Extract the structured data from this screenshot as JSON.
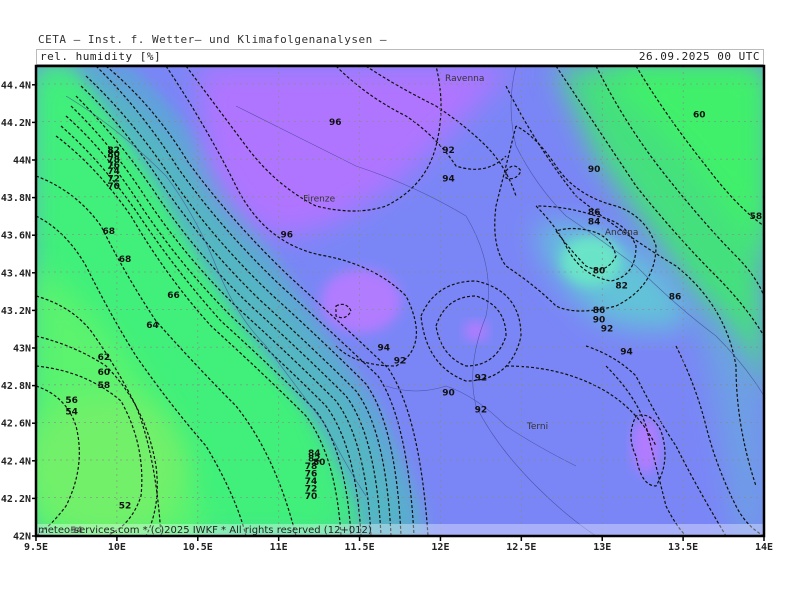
{
  "header": {
    "title": "CETA — Inst. f. Wetter— und Klimafolgenanalysen —",
    "parameter": "rel. humidity [%]",
    "datetime": "26.09.2025 00 UTC"
  },
  "map": {
    "lon_range": [
      9.5,
      14.0
    ],
    "lat_range": [
      42.0,
      44.5
    ],
    "x_ticks": [
      "9.5E",
      "10E",
      "10.5E",
      "11E",
      "11.5E",
      "12E",
      "12.5E",
      "13E",
      "13.5E",
      "14E"
    ],
    "y_ticks": [
      "42N",
      "42.2N",
      "42.4N",
      "42.6N",
      "42.8N",
      "43N",
      "43.2N",
      "43.4N",
      "43.6N",
      "43.8N",
      "44N",
      "44.2N",
      "44.4N"
    ],
    "cities": [
      {
        "name": "Ravenna",
        "lon": 12.15,
        "lat": 44.42
      },
      {
        "name": "Firenze",
        "lon": 11.25,
        "lat": 43.78
      },
      {
        "name": "Ancona",
        "lon": 13.12,
        "lat": 43.6
      },
      {
        "name": "Terni",
        "lon": 12.6,
        "lat": 42.57
      }
    ],
    "contour_labels": [
      {
        "text": "96",
        "lon": 11.35,
        "lat": 44.2
      },
      {
        "text": "92",
        "lon": 12.05,
        "lat": 44.05
      },
      {
        "text": "94",
        "lon": 12.05,
        "lat": 43.9
      },
      {
        "text": "90",
        "lon": 12.95,
        "lat": 43.95
      },
      {
        "text": "96",
        "lon": 11.05,
        "lat": 43.6
      },
      {
        "text": "94",
        "lon": 11.65,
        "lat": 43.0
      },
      {
        "text": "92",
        "lon": 11.75,
        "lat": 42.93
      },
      {
        "text": "90",
        "lon": 12.05,
        "lat": 42.76
      },
      {
        "text": "92",
        "lon": 12.25,
        "lat": 42.84
      },
      {
        "text": "92",
        "lon": 12.25,
        "lat": 42.67
      },
      {
        "text": "86",
        "lon": 12.95,
        "lat": 43.72
      },
      {
        "text": "84",
        "lon": 12.95,
        "lat": 43.67
      },
      {
        "text": "80",
        "lon": 12.98,
        "lat": 43.41
      },
      {
        "text": "82",
        "lon": 13.12,
        "lat": 43.33
      },
      {
        "text": "86",
        "lon": 12.98,
        "lat": 43.2
      },
      {
        "text": "90",
        "lon": 12.98,
        "lat": 43.15
      },
      {
        "text": "92",
        "lon": 13.03,
        "lat": 43.1
      },
      {
        "text": "94",
        "lon": 13.15,
        "lat": 42.98
      },
      {
        "text": "86",
        "lon": 13.45,
        "lat": 43.27
      },
      {
        "text": "60",
        "lon": 13.6,
        "lat": 44.24
      },
      {
        "text": "58",
        "lon": 13.95,
        "lat": 43.7
      },
      {
        "text": "68",
        "lon": 9.95,
        "lat": 43.62
      },
      {
        "text": "68",
        "lon": 10.05,
        "lat": 43.47
      },
      {
        "text": "66",
        "lon": 10.35,
        "lat": 43.28
      },
      {
        "text": "64",
        "lon": 10.22,
        "lat": 43.12
      },
      {
        "text": "62",
        "lon": 9.92,
        "lat": 42.95
      },
      {
        "text": "60",
        "lon": 9.92,
        "lat": 42.87
      },
      {
        "text": "58",
        "lon": 9.92,
        "lat": 42.8
      },
      {
        "text": "56",
        "lon": 9.72,
        "lat": 42.72
      },
      {
        "text": "54",
        "lon": 9.72,
        "lat": 42.66
      },
      {
        "text": "52",
        "lon": 10.05,
        "lat": 42.16
      },
      {
        "text": "54",
        "lon": 9.75,
        "lat": 42.03
      },
      {
        "text": "70",
        "lon": 9.98,
        "lat": 43.86
      },
      {
        "text": "72",
        "lon": 9.98,
        "lat": 43.9
      },
      {
        "text": "74",
        "lon": 9.98,
        "lat": 43.94
      },
      {
        "text": "76",
        "lon": 9.98,
        "lat": 43.97
      },
      {
        "text": "78",
        "lon": 9.98,
        "lat": 44.0
      },
      {
        "text": "80",
        "lon": 9.98,
        "lat": 44.03
      },
      {
        "text": "82",
        "lon": 9.98,
        "lat": 44.05
      },
      {
        "text": "84",
        "lon": 11.22,
        "lat": 42.44
      },
      {
        "text": "82",
        "lon": 11.22,
        "lat": 42.41
      },
      {
        "text": "80",
        "lon": 11.25,
        "lat": 42.39
      },
      {
        "text": "78",
        "lon": 11.2,
        "lat": 42.37
      },
      {
        "text": "76",
        "lon": 11.2,
        "lat": 42.33
      },
      {
        "text": "74",
        "lon": 11.2,
        "lat": 42.29
      },
      {
        "text": "72",
        "lon": 11.2,
        "lat": 42.25
      },
      {
        "text": "70",
        "lon": 11.2,
        "lat": 42.21
      }
    ],
    "copyright": "meteo-services.com * (c)2025 IWKF * All rights reserved (12+012)"
  }
}
